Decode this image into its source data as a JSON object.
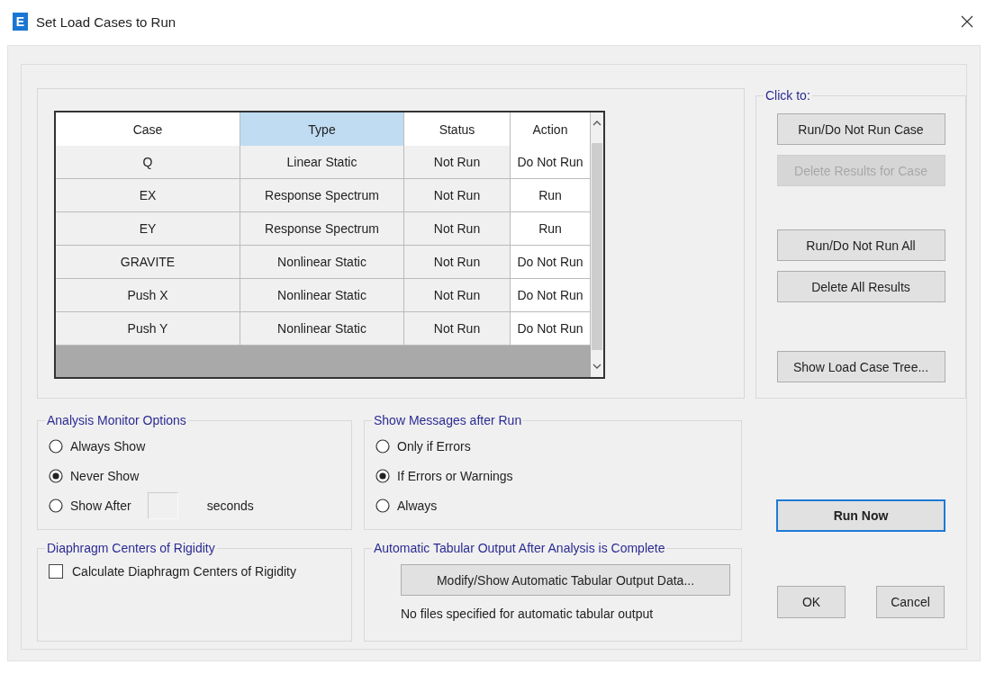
{
  "window": {
    "title": "Set Load Cases to Run",
    "icon_letter": "E"
  },
  "cases_table": {
    "columns": [
      {
        "label": "Case",
        "selected": false,
        "editable": false
      },
      {
        "label": "Type",
        "selected": true,
        "editable": false
      },
      {
        "label": "Status",
        "selected": false,
        "editable": false
      },
      {
        "label": "Action",
        "selected": false,
        "editable": true
      }
    ],
    "rows": [
      [
        "Q",
        "Linear Static",
        "Not Run",
        "Do Not Run"
      ],
      [
        "EX",
        "Response Spectrum",
        "Not Run",
        "Run"
      ],
      [
        "EY",
        "Response Spectrum",
        "Not Run",
        "Run"
      ],
      [
        "GRAVITE",
        "Nonlinear Static",
        "Not Run",
        "Do Not Run"
      ],
      [
        "Push X",
        "Nonlinear Static",
        "Not Run",
        "Do Not Run"
      ],
      [
        "Push Y",
        "Nonlinear Static",
        "Not Run",
        "Do Not Run"
      ]
    ]
  },
  "click_to": {
    "legend": "Click to:",
    "button_groups": [
      [
        {
          "label": "Run/Do Not Run Case",
          "disabled": false
        },
        {
          "label": "Delete Results for Case",
          "disabled": true
        }
      ],
      [
        {
          "label": "Run/Do Not Run All",
          "disabled": false
        },
        {
          "label": "Delete All Results",
          "disabled": false
        }
      ],
      [
        {
          "label": "Show Load Case Tree...",
          "disabled": false
        }
      ]
    ]
  },
  "analysis_monitor": {
    "legend": "Analysis Monitor Options",
    "options": [
      {
        "kind": "plain",
        "label": "Always Show",
        "selected": false
      },
      {
        "kind": "plain",
        "label": "Never Show",
        "selected": true
      },
      {
        "kind": "with_field",
        "label": "Show After",
        "selected": false,
        "suffix": "seconds"
      }
    ]
  },
  "show_messages": {
    "legend": "Show Messages after Run",
    "options": [
      {
        "kind": "plain",
        "label": "Only if Errors",
        "selected": false
      },
      {
        "kind": "plain",
        "label": "If Errors or Warnings",
        "selected": true
      },
      {
        "kind": "plain",
        "label": "Always",
        "selected": false
      }
    ]
  },
  "diaphragm": {
    "legend": "Diaphragm Centers of Rigidity",
    "checkbox": {
      "label": "Calculate Diaphragm Centers of Rigidity",
      "checked": false
    }
  },
  "tabular_output": {
    "legend": "Automatic Tabular Output After Analysis is Complete",
    "button": {
      "label": "Modify/Show Automatic Tabular Output Data..."
    },
    "note": "No files specified for automatic tabular output"
  },
  "run_button": {
    "label": "Run Now",
    "focused": true
  },
  "dialog_buttons": [
    {
      "label": "OK",
      "focused": false
    },
    {
      "label": "Cancel",
      "focused": false
    }
  ]
}
